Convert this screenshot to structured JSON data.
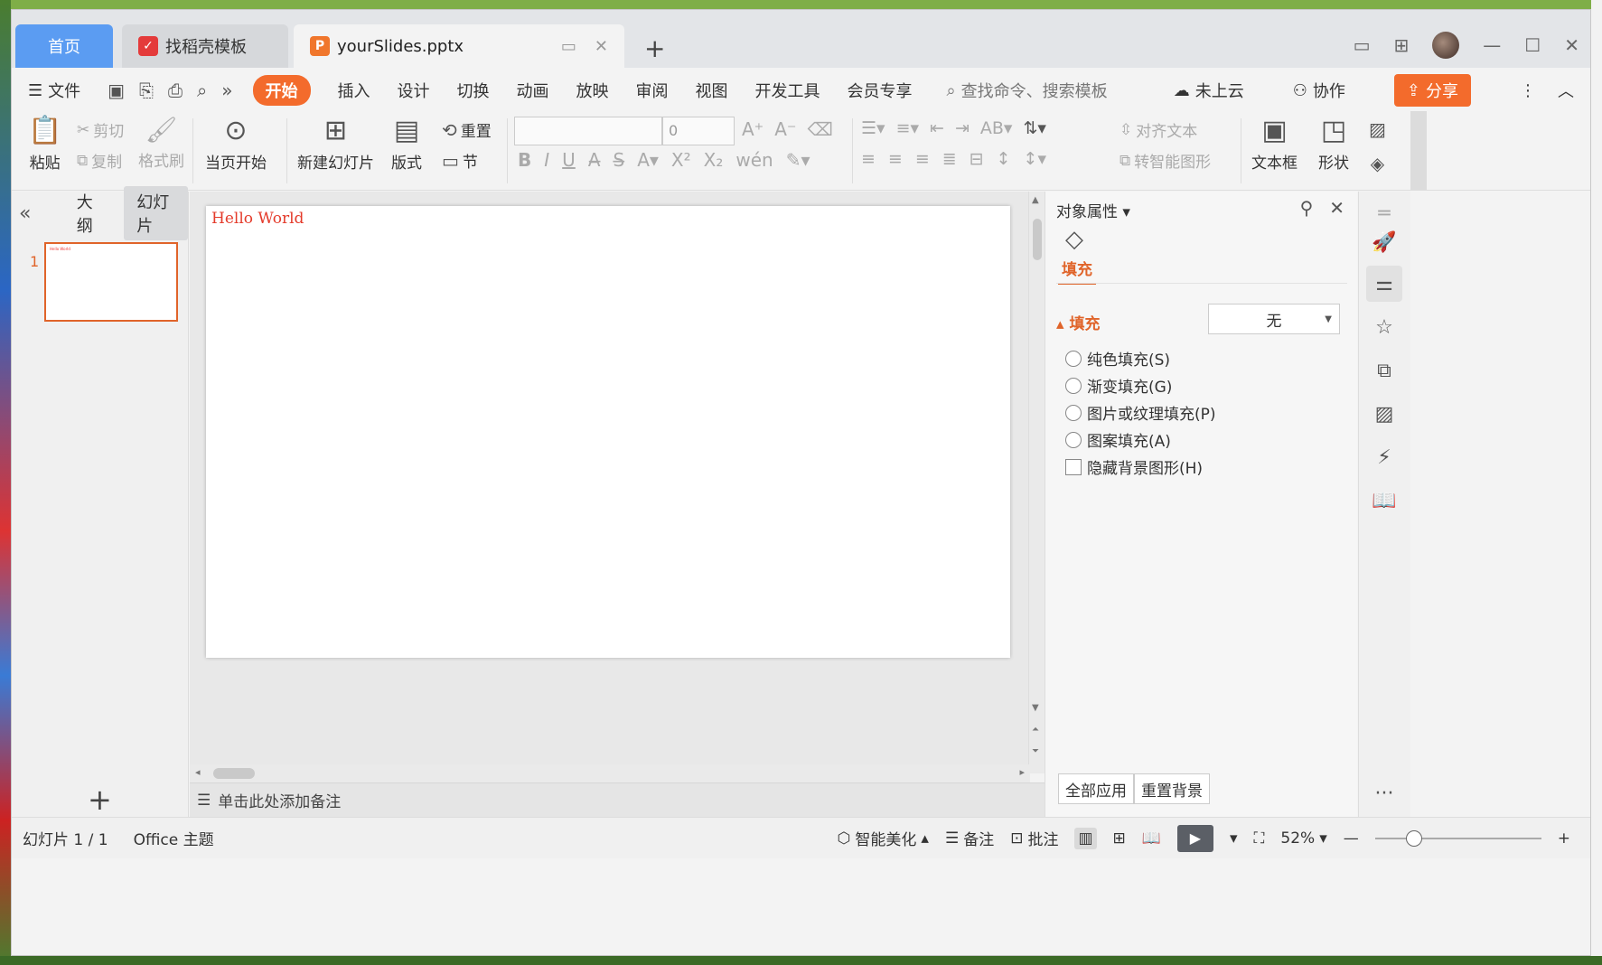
{
  "tabs": {
    "home": "首页",
    "template": "找稻壳模板",
    "file": "yourSlides.pptx"
  },
  "menu": {
    "file": "文件",
    "items": [
      "开始",
      "插入",
      "设计",
      "切换",
      "动画",
      "放映",
      "审阅",
      "视图",
      "开发工具",
      "会员专享"
    ],
    "search_placeholder": "查找命令、搜索模板",
    "cloud": "未上云",
    "collab": "协作",
    "share": "分享"
  },
  "ribbon": {
    "paste": "粘贴",
    "cut": "剪切",
    "copy": "复制",
    "format_painter": "格式刷",
    "from_current": "当页开始",
    "new_slide": "新建幻灯片",
    "layout": "版式",
    "reset": "重置",
    "section": "节",
    "font_size": "0",
    "align_text": "对齐文本",
    "smart_shape": "转智能图形",
    "textbox": "文本框",
    "shapes": "形状"
  },
  "left_panel": {
    "tab_outline": "大纲",
    "tab_slides": "幻灯片",
    "slide_number": "1",
    "thumb_text": "Hello World"
  },
  "slide": {
    "text": "Hello World",
    "text_color": "#e43b2b"
  },
  "notes": {
    "placeholder": "单击此处添加备注"
  },
  "properties": {
    "title": "对象属性",
    "tab_fill": "填充",
    "section_fill": "填充",
    "fill_value": "无",
    "options": [
      "纯色填充(S)",
      "渐变填充(G)",
      "图片或纹理填充(P)",
      "图案填充(A)"
    ],
    "hide_bg": "隐藏背景图形(H)",
    "apply_all": "全部应用",
    "reset_bg": "重置背景"
  },
  "status": {
    "slide_count": "幻灯片 1 / 1",
    "theme": "Office 主题",
    "beautify": "智能美化",
    "notes": "备注",
    "comments": "批注",
    "zoom": "52%"
  },
  "colors": {
    "accent": "#f36b2c",
    "home_tab": "#5b9cf2"
  }
}
